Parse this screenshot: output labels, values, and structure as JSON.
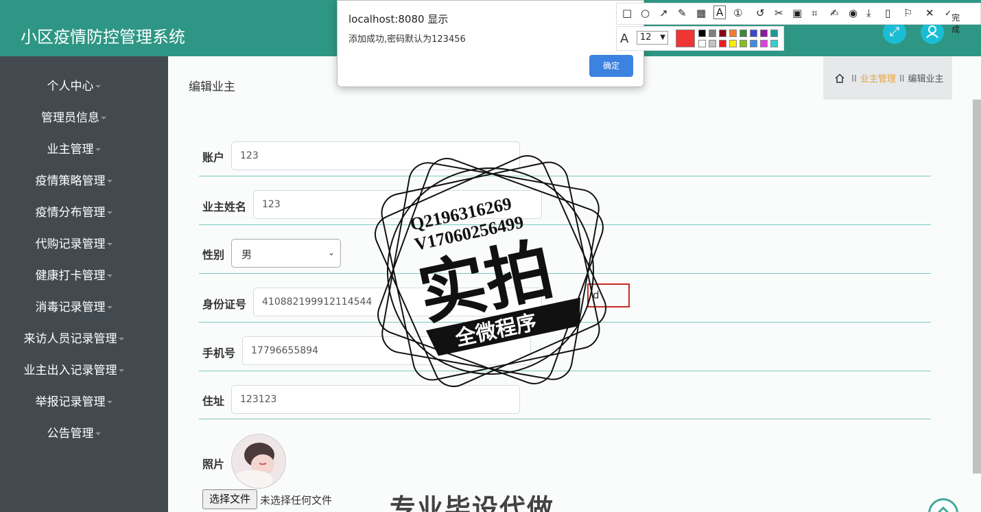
{
  "app": {
    "title": "小区疫情防控管理系统"
  },
  "header": {
    "fullscreen_icon": "expand-icon",
    "user_icon": "user-icon"
  },
  "sidebar": {
    "items": [
      {
        "label": "个人中心"
      },
      {
        "label": "管理员信息"
      },
      {
        "label": "业主管理"
      },
      {
        "label": "疫情策略管理"
      },
      {
        "label": "疫情分布管理"
      },
      {
        "label": "代购记录管理"
      },
      {
        "label": "健康打卡管理"
      },
      {
        "label": "消毒记录管理"
      },
      {
        "label": "来访人员记录管理"
      },
      {
        "label": "业主出入记录管理"
      },
      {
        "label": "举报记录管理"
      },
      {
        "label": "公告管理"
      }
    ]
  },
  "page": {
    "heading": "编辑业主"
  },
  "breadcrumb": {
    "home_icon": "home-icon",
    "sep": "II",
    "section": "业主管理",
    "current": "编辑业主"
  },
  "form": {
    "account": {
      "label": "账户",
      "value": "123"
    },
    "owner_name": {
      "label": "业主姓名",
      "value": "123"
    },
    "gender": {
      "label": "性别",
      "value": "男"
    },
    "id_number": {
      "label": "身份证号",
      "value": "410882199912114544"
    },
    "phone": {
      "label": "手机号",
      "value": "17796655894"
    },
    "address": {
      "label": "住址",
      "value": "123123"
    },
    "photo": {
      "label": "照片"
    },
    "file_button": "选择文件",
    "file_status": "未选择任何文件"
  },
  "dialog": {
    "title": "localhost:8080 显示",
    "message": "添加成功,密码默认为123456",
    "ok": "确定"
  },
  "annotation_toolbar": {
    "done": "完成",
    "font_size": "12",
    "current_color": "#f03535",
    "palette": [
      "#000000",
      "#7f7f7f",
      "#880015",
      "#f07c30",
      "#3a8a3a",
      "#3f48cc",
      "#8b1a9b",
      "#1a9b9b",
      "#ffffff",
      "#c3c3c3",
      "#ed1c24",
      "#ffee00",
      "#84c01e",
      "#3f8fe0",
      "#e040e0",
      "#35d0d0"
    ]
  },
  "annotation_text": "d",
  "watermark": {
    "line1": "Q2196316269",
    "line2": "V17060256499",
    "main": "实拍",
    "banner": "全微程序",
    "bottom": "专业毕设代做"
  },
  "colors": {
    "header": "#2e9684",
    "sidebar": "#424a50",
    "accent": "#e9a23b"
  }
}
